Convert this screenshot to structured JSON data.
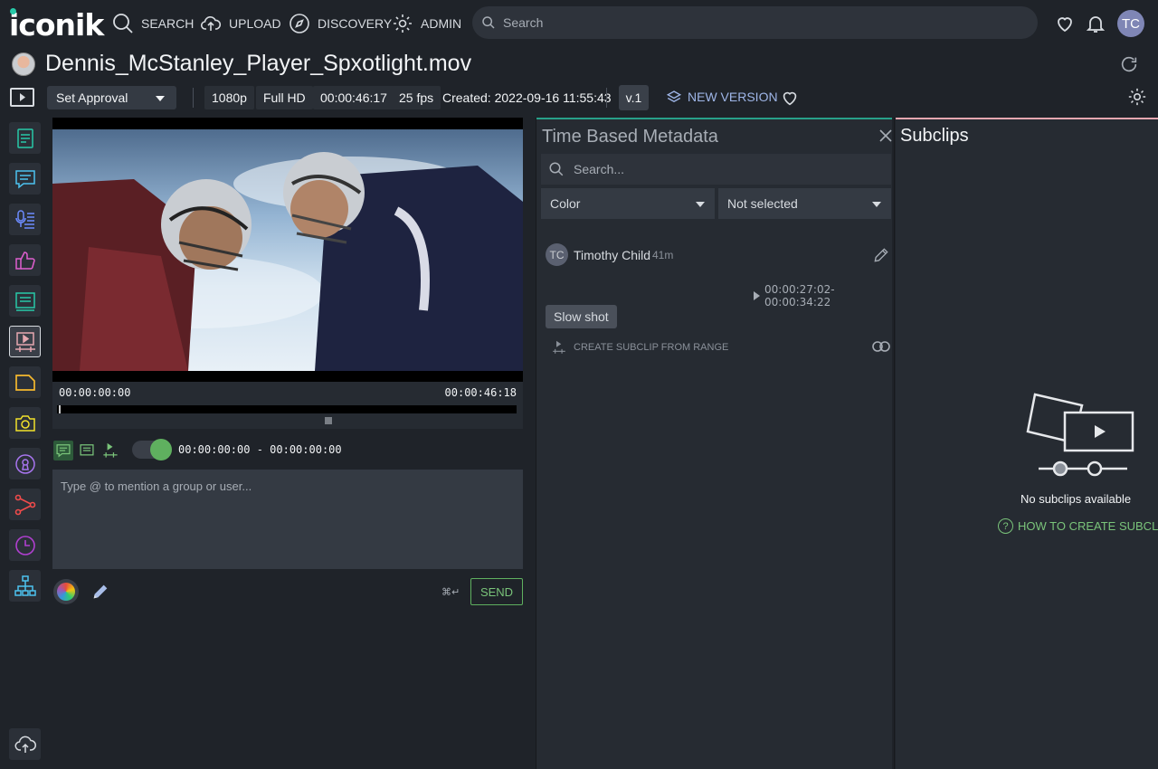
{
  "app": {
    "logo": "iconik",
    "nav": [
      {
        "id": "search",
        "label": "SEARCH",
        "icon": "search-icon"
      },
      {
        "id": "upload",
        "label": "UPLOAD",
        "icon": "upload-cloud-icon"
      },
      {
        "id": "discovery",
        "label": "DISCOVERY",
        "icon": "compass-icon"
      },
      {
        "id": "admin",
        "label": "ADMIN",
        "icon": "gear-icon"
      }
    ],
    "search_placeholder": "Search",
    "user_initials": "TC"
  },
  "asset": {
    "title": "Dennis_McStanley_Player_Spxotlight.mov"
  },
  "toolbar": {
    "approval": "Set Approval",
    "resolution": "1080p",
    "quality": "Full HD",
    "duration": "00:00:46:17",
    "fps": "25 fps",
    "created": "Created: 2022-09-16 11:55:43",
    "version": "v.1",
    "new_version": "NEW VERSION"
  },
  "rail": [
    {
      "name": "metadata-icon",
      "color": "#27c9a8"
    },
    {
      "name": "comments-icon",
      "color": "#4cc3f0"
    },
    {
      "name": "transcription-icon",
      "color": "#6d8cff"
    },
    {
      "name": "approval-icon",
      "color": "#e05fd0"
    },
    {
      "name": "segments-icon",
      "color": "#27c9a8"
    },
    {
      "name": "subclips-icon",
      "color": "#e6a7b0",
      "active": true
    },
    {
      "name": "collections-icon",
      "color": "#f5b82e"
    },
    {
      "name": "snapshot-icon",
      "color": "#f2e12a"
    },
    {
      "name": "permissions-icon",
      "color": "#a875f0"
    },
    {
      "name": "share-icon",
      "color": "#f04b4b"
    },
    {
      "name": "history-icon",
      "color": "#b03fd0"
    },
    {
      "name": "relations-icon",
      "color": "#4cc3f0"
    }
  ],
  "player": {
    "timecode_start": "00:00:00:00",
    "timecode_end": "00:00:46:18",
    "range": "00:00:00:00 - 00:00:00:00"
  },
  "comment": {
    "placeholder": "Type @ to mention a group or user...",
    "shortcut": "⌘↵",
    "send_label": "SEND"
  },
  "time_based_metadata": {
    "title": "Time Based Metadata",
    "search_placeholder": "Search...",
    "filter_field": "Color",
    "filter_value": "Not selected",
    "entries": [
      {
        "avatar_initials": "TC",
        "author": "Timothy Child",
        "age": "41m",
        "range": "00:00:27:02-00:00:34:22",
        "tag": "Slow shot",
        "action": "CREATE SUBCLIP FROM RANGE"
      }
    ]
  },
  "subclips": {
    "title": "Subclips",
    "empty_text": "No subclips available",
    "howto_label": "HOW TO CREATE SUBCLIP"
  },
  "colors": {
    "accent_green": "#7ac47a",
    "accent_teal": "#27a089",
    "accent_pink": "#e6a7b0"
  }
}
